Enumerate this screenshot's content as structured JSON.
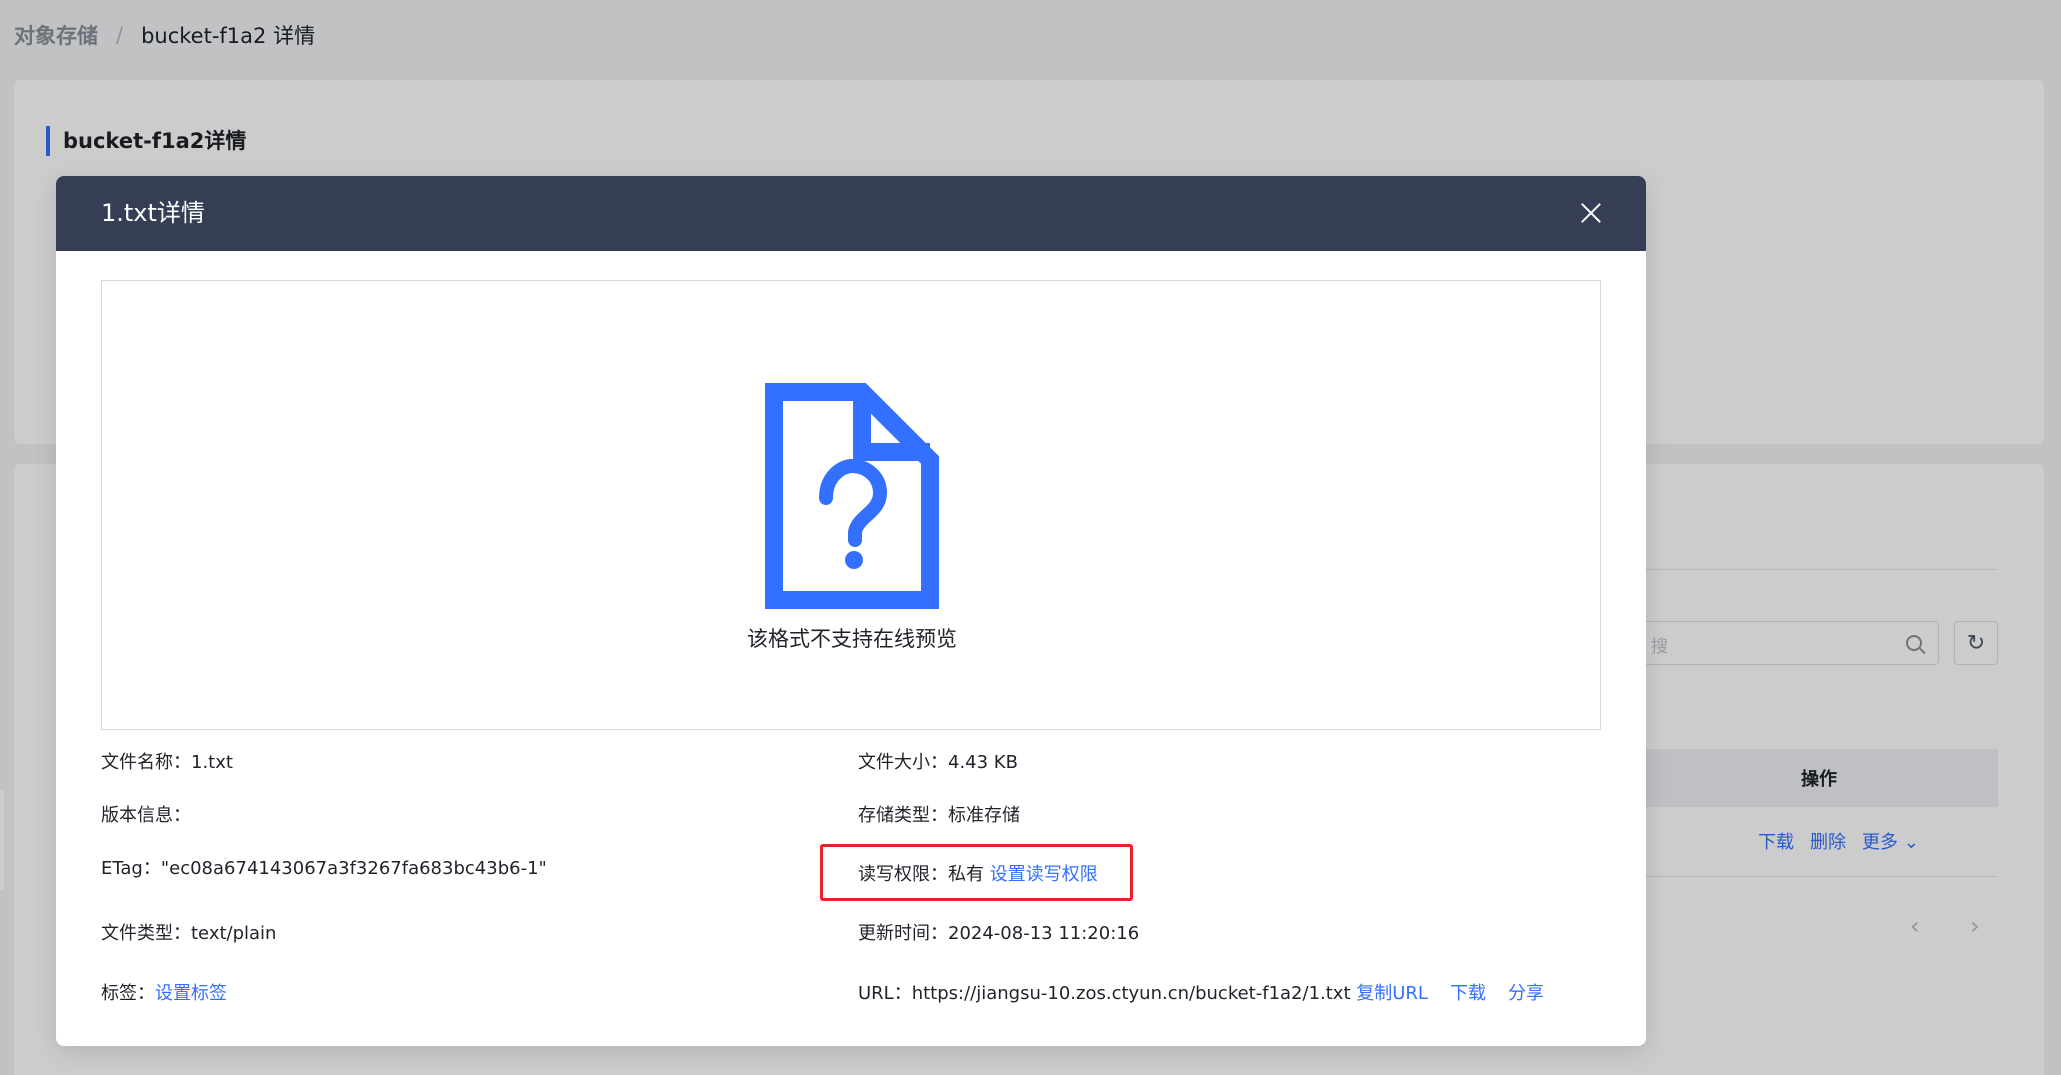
{
  "breadcrumb": {
    "root": "对象存储",
    "separator": "/",
    "current": "bucket-f1a2 详情"
  },
  "background": {
    "card_title": "bucket-f1a2详情",
    "search_placeholder": "搜",
    "table_header_ops": "操作",
    "row_ops": [
      "下载",
      "删除",
      "更多"
    ],
    "pager_prev": "‹",
    "pager_next": "›"
  },
  "modal": {
    "title": "1.txt详情",
    "preview_message": "该格式不支持在线预览",
    "icon": "file-question-icon",
    "left": {
      "file_name_label": "文件名称：",
      "file_name": "1.txt",
      "version_label": "版本信息：",
      "version": "",
      "etag_label": "ETag：",
      "etag": "\"ec08a674143067a3f3267fa683bc43b6-1\"",
      "file_type_label": "文件类型：",
      "file_type": "text/plain",
      "tags_label": "标签：",
      "tags_link": "设置标签"
    },
    "right": {
      "size_label": "文件大小：",
      "size": "4.43 KB",
      "storage_label": "存储类型：",
      "storage": "标准存储",
      "acl_label": "读写权限：",
      "acl": "私有",
      "acl_link": "设置读写权限",
      "updated_label": "更新时间：",
      "updated": "2024-08-13 11:20:16",
      "url_label": "URL：",
      "url": "https://jiangsu-10.zos.ctyun.cn/bucket-f1a2/1.txt",
      "copy_url": "复制URL",
      "download": "下载",
      "share": "分享"
    }
  },
  "colors": {
    "accent": "#3370ff",
    "modal_header": "#363e55",
    "highlight": "#e8202a"
  }
}
